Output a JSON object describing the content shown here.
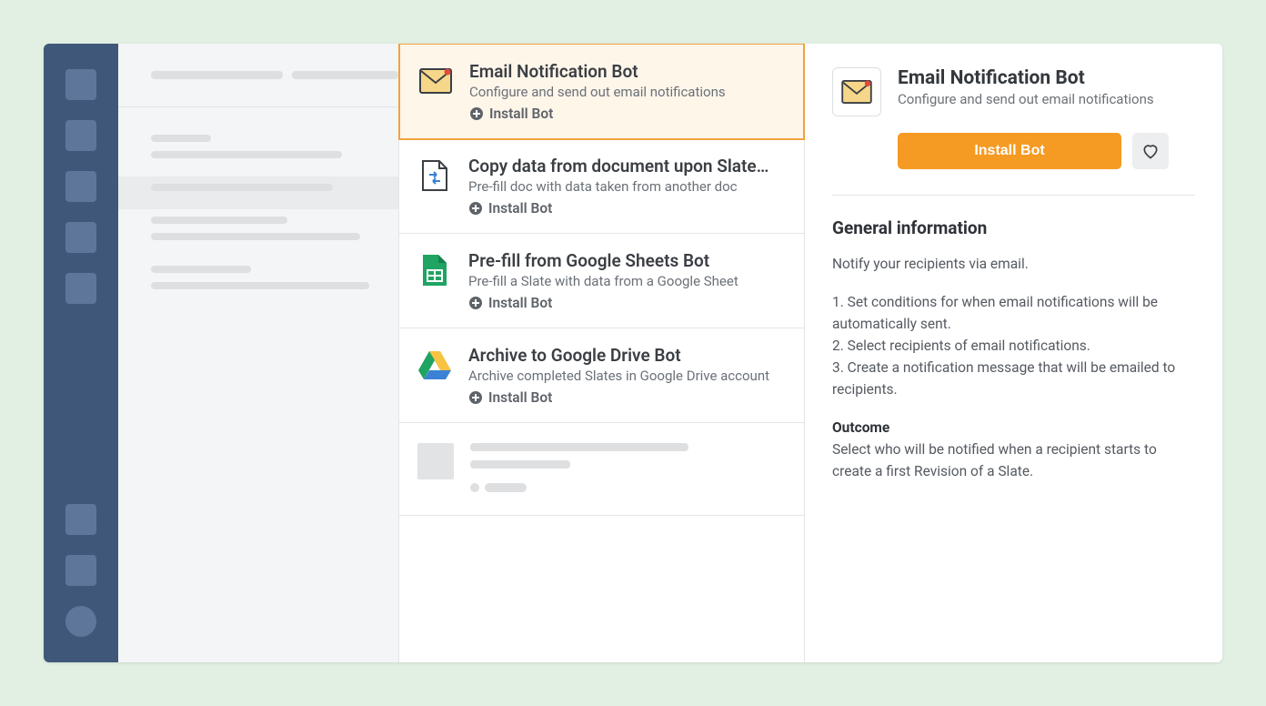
{
  "bots": [
    {
      "title": "Email Notification Bot",
      "desc": "Configure and send out email notifications",
      "install": "Install Bot",
      "icon": "email"
    },
    {
      "title": "Copy data from document upon Slate…",
      "desc": "Pre-fill doc with data taken from another doc",
      "install": "Install Bot",
      "icon": "doc"
    },
    {
      "title": "Pre-fill from Google Sheets Bot",
      "desc": "Pre-fill a Slate with data from a Google Sheet",
      "install": "Install Bot",
      "icon": "sheets"
    },
    {
      "title": "Archive to Google Drive Bot",
      "desc": "Archive completed Slates in Google Drive account",
      "install": "Install Bot",
      "icon": "drive"
    }
  ],
  "detail": {
    "title": "Email Notification Bot",
    "desc": "Configure and send out email notifications",
    "install_btn": "Install Bot",
    "section_title": "General information",
    "intro": "Notify your recipients via email.",
    "step1": "1. Set conditions for when email notifications will be automatically sent.",
    "step2": "2. Select recipients of email notifications.",
    "step3": "3. Create a notification message that will be emailed to recipients.",
    "outcome_label": "Outcome",
    "outcome_text": "Select who will be notified when a recipient starts to create a first Revision of a Slate."
  }
}
